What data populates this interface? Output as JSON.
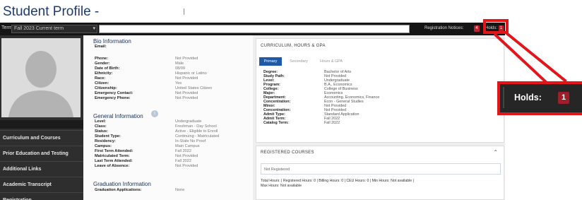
{
  "header": {
    "title": "Student Profile -"
  },
  "term_bar": {
    "term_label": "Term:",
    "term_value": "Fall 2023 Current term",
    "registration_notices_label": "Registration Notices:",
    "registration_notices_count": "4",
    "holds_label": "Holds:",
    "holds_count": "1"
  },
  "sidebar": {
    "items": [
      {
        "label": "Curriculum and Courses"
      },
      {
        "label": "Prior Education and Testing"
      },
      {
        "label": "Additional Links"
      },
      {
        "label": "Academic Transcript"
      },
      {
        "label": "Registration"
      }
    ]
  },
  "bio": {
    "title": "Bio Information",
    "rows": [
      {
        "label": "Email:",
        "value": ""
      },
      {
        "label": "Phone:",
        "value": "Not Provided"
      },
      {
        "label": "Gender:",
        "value": "Male"
      },
      {
        "label": "Date of Birth:",
        "value": "08/09"
      },
      {
        "label": "Ethnicity:",
        "value": "Hispanic or Latino"
      },
      {
        "label": "Race:",
        "value": "Not Provided"
      },
      {
        "label": "Citizen:",
        "value": "Yes"
      },
      {
        "label": "Citizenship:",
        "value": "United States Citizen"
      },
      {
        "label": "Emergency Contact:",
        "value": "Not Provided"
      },
      {
        "label": "Emergency Phone:",
        "value": "Not Provided"
      }
    ]
  },
  "general": {
    "title": "General Information",
    "rows": [
      {
        "label": "Level:",
        "value": "Undergraduate"
      },
      {
        "label": "Class:",
        "value": "Freshman - Day School"
      },
      {
        "label": "Status:",
        "value": "Active - Eligible to Enroll"
      },
      {
        "label": "Student Type:",
        "value": "Continuing - Matriculated"
      },
      {
        "label": "Residency:",
        "value": "In-State No Proof"
      },
      {
        "label": "Campus:",
        "value": "Main Campus"
      },
      {
        "label": "First Term Attended:",
        "value": "Fall 2022"
      },
      {
        "label": "Matriculated Term:",
        "value": "Not Provided"
      },
      {
        "label": "Last Term Attended:",
        "value": "Fall 2022"
      },
      {
        "label": "Leave of Absence:",
        "value": "Not Provided"
      }
    ]
  },
  "graduation": {
    "title": "Graduation Information",
    "rows": [
      {
        "label": "Graduation Applications:",
        "value": "None"
      }
    ]
  },
  "curriculum": {
    "title": "CURRICULUM, HOURS & GPA",
    "tabs": [
      {
        "label": "Primary"
      },
      {
        "label": "Secondary"
      },
      {
        "label": "Hours & GPA"
      }
    ],
    "rows": [
      {
        "label": "Degree:",
        "value": "Bachelor of Arts"
      },
      {
        "label": "Study Path:",
        "value": "Not Provided"
      },
      {
        "label": "Level:",
        "value": "Undergraduate"
      },
      {
        "label": "Program:",
        "value": "B.A., Economics"
      },
      {
        "label": "College:",
        "value": "College of Business"
      },
      {
        "label": "Major:",
        "value": "Economics"
      },
      {
        "label": "Department:",
        "value": "Accounting, Economics, Finance"
      },
      {
        "label": "Concentration:",
        "value": "Econ - General Studies"
      },
      {
        "label": "Minor:",
        "value": "Not Provided"
      },
      {
        "label": "Concentration:",
        "value": "Not Provided"
      },
      {
        "label": "Admit Type:",
        "value": "Standard Application"
      },
      {
        "label": "Admit Term:",
        "value": "Fall 2022"
      },
      {
        "label": "Catalog Term:",
        "value": "Fall 2022"
      }
    ]
  },
  "registered": {
    "title": "REGISTERED COURSES",
    "empty_text": "Not Registered",
    "hours_line_1": "Total Hours: | Registered Hours: 0 | Billing Hours: 0 | CEU Hours: 0 | Min Hours: Not available |",
    "hours_line_2": "Max Hours: Not available"
  },
  "callout": {
    "holds_label": "Holds:",
    "holds_count": "1"
  },
  "colors": {
    "accent_red": "#e4141b",
    "badge_red": "#b8232f",
    "primary_blue": "#1f5aa8",
    "title_blue": "#1f3b6e"
  }
}
